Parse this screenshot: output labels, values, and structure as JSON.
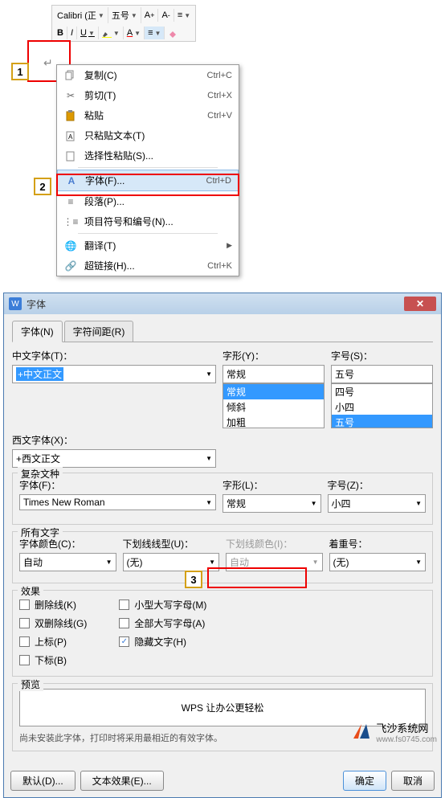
{
  "toolbar": {
    "font": "Calibri (正",
    "size": "五号",
    "incSize": "A",
    "decSize": "A"
  },
  "contextMenu": {
    "copy": "复制(C)",
    "copyKey": "Ctrl+C",
    "cut": "剪切(T)",
    "cutKey": "Ctrl+X",
    "paste": "粘贴",
    "pasteKey": "Ctrl+V",
    "pasteText": "只粘贴文本(T)",
    "pasteSpecial": "选择性粘贴(S)...",
    "font": "字体(F)...",
    "fontKey": "Ctrl+D",
    "paragraph": "段落(P)...",
    "bullets": "项目符号和编号(N)...",
    "translate": "翻译(T)",
    "hyperlink": "超链接(H)...",
    "hyperlinkKey": "Ctrl+K"
  },
  "dialog": {
    "title": "字体",
    "tabs": {
      "font": "字体(N)",
      "spacing": "字符间距(R)"
    },
    "cnFontLabel": "中文字体(T)：",
    "cnFont": "+中文正文",
    "enFontLabel": "西文字体(X)：",
    "enFont": "+西文正文",
    "styleLabel": "字形(Y)：",
    "style": "常规",
    "styleOptions": [
      "常规",
      "倾斜",
      "加粗"
    ],
    "sizeLabel": "字号(S)：",
    "size": "五号",
    "sizeOptions": [
      "四号",
      "小四",
      "五号"
    ],
    "complexLegend": "复杂文种",
    "complexFontLabel": "字体(F)：",
    "complexFont": "Times New Roman",
    "complexStyleLabel": "字形(L)：",
    "complexStyle": "常规",
    "complexSizeLabel": "字号(Z)：",
    "complexSize": "小四",
    "allTextLegend": "所有文字",
    "fontColorLabel": "字体颜色(C)：",
    "fontColor": "自动",
    "underlineLabel": "下划线线型(U)：",
    "underline": "(无)",
    "underlineColorLabel": "下划线颜色(I)：",
    "underlineColor": "自动",
    "emphasisLabel": "着重号：",
    "emphasis": "(无)",
    "effectsLegend": "效果",
    "strike": "删除线(K)",
    "dstrike": "双删除线(G)",
    "superscript": "上标(P)",
    "subscript": "下标(B)",
    "smallCaps": "小型大写字母(M)",
    "allCaps": "全部大写字母(A)",
    "hidden": "隐藏文字(H)",
    "previewLegend": "预览",
    "previewText": "WPS 让办公更轻松",
    "previewNote": "尚未安装此字体，打印时将采用最相近的有效字体。",
    "defaultBtn": "默认(D)...",
    "textEffectBtn": "文本效果(E)...",
    "okBtn": "确定",
    "cancelBtn": "取消"
  },
  "watermark": {
    "name": "飞沙系统网",
    "url": "www.fs0745.com"
  }
}
